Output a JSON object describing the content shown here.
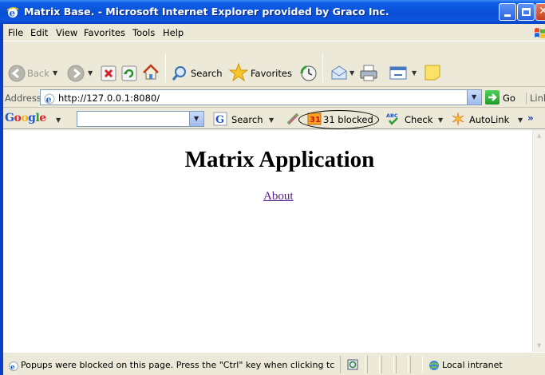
{
  "window": {
    "title": "Matrix Base. - Microsoft Internet Explorer provided by Graco Inc."
  },
  "menu": [
    "File",
    "Edit",
    "View",
    "Favorites",
    "Tools",
    "Help"
  ],
  "toolbar": {
    "back_label": "Back",
    "search_label": "Search",
    "favorites_label": "Favorites"
  },
  "address": {
    "label": "Address",
    "url": "http://127.0.0.1:8080/",
    "go_label": "Go",
    "links_label": "Links"
  },
  "google_toolbar": {
    "logo": "Google",
    "search_value": "",
    "search_label": "Search",
    "blocked_label": "31 blocked",
    "check_label": "Check",
    "autolink_label": "AutoLink",
    "more_label": "»"
  },
  "page": {
    "heading": "Matrix Application",
    "about_link": "About"
  },
  "status": {
    "message": "Popups were blocked on this page. Press the \"Ctrl\" key when clicking tc",
    "zone": "Local intranet"
  },
  "colors": {
    "titlebar": "#0a4fd6",
    "chrome": "#ece9d8",
    "visited_link": "#551a8b"
  }
}
